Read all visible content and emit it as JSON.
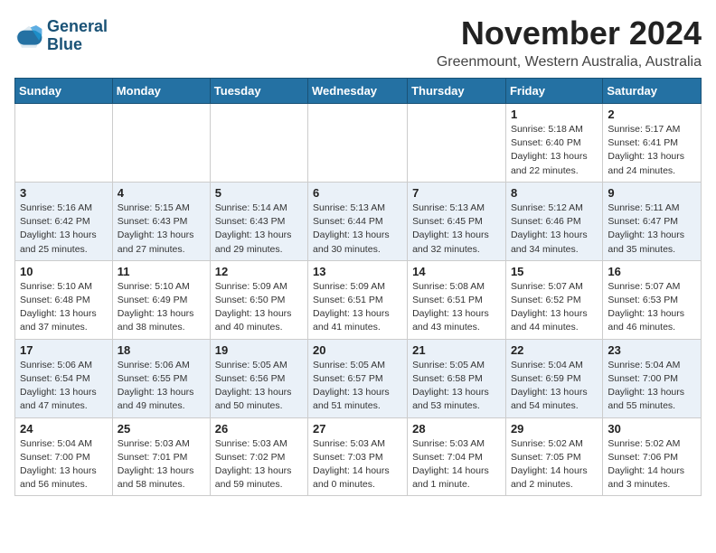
{
  "logo": {
    "line1": "General",
    "line2": "Blue"
  },
  "title": "November 2024",
  "subtitle": "Greenmount, Western Australia, Australia",
  "header": {
    "days": [
      "Sunday",
      "Monday",
      "Tuesday",
      "Wednesday",
      "Thursday",
      "Friday",
      "Saturday"
    ]
  },
  "weeks": [
    [
      {
        "day": "",
        "info": ""
      },
      {
        "day": "",
        "info": ""
      },
      {
        "day": "",
        "info": ""
      },
      {
        "day": "",
        "info": ""
      },
      {
        "day": "",
        "info": ""
      },
      {
        "day": "1",
        "info": "Sunrise: 5:18 AM\nSunset: 6:40 PM\nDaylight: 13 hours\nand 22 minutes."
      },
      {
        "day": "2",
        "info": "Sunrise: 5:17 AM\nSunset: 6:41 PM\nDaylight: 13 hours\nand 24 minutes."
      }
    ],
    [
      {
        "day": "3",
        "info": "Sunrise: 5:16 AM\nSunset: 6:42 PM\nDaylight: 13 hours\nand 25 minutes."
      },
      {
        "day": "4",
        "info": "Sunrise: 5:15 AM\nSunset: 6:43 PM\nDaylight: 13 hours\nand 27 minutes."
      },
      {
        "day": "5",
        "info": "Sunrise: 5:14 AM\nSunset: 6:43 PM\nDaylight: 13 hours\nand 29 minutes."
      },
      {
        "day": "6",
        "info": "Sunrise: 5:13 AM\nSunset: 6:44 PM\nDaylight: 13 hours\nand 30 minutes."
      },
      {
        "day": "7",
        "info": "Sunrise: 5:13 AM\nSunset: 6:45 PM\nDaylight: 13 hours\nand 32 minutes."
      },
      {
        "day": "8",
        "info": "Sunrise: 5:12 AM\nSunset: 6:46 PM\nDaylight: 13 hours\nand 34 minutes."
      },
      {
        "day": "9",
        "info": "Sunrise: 5:11 AM\nSunset: 6:47 PM\nDaylight: 13 hours\nand 35 minutes."
      }
    ],
    [
      {
        "day": "10",
        "info": "Sunrise: 5:10 AM\nSunset: 6:48 PM\nDaylight: 13 hours\nand 37 minutes."
      },
      {
        "day": "11",
        "info": "Sunrise: 5:10 AM\nSunset: 6:49 PM\nDaylight: 13 hours\nand 38 minutes."
      },
      {
        "day": "12",
        "info": "Sunrise: 5:09 AM\nSunset: 6:50 PM\nDaylight: 13 hours\nand 40 minutes."
      },
      {
        "day": "13",
        "info": "Sunrise: 5:09 AM\nSunset: 6:51 PM\nDaylight: 13 hours\nand 41 minutes."
      },
      {
        "day": "14",
        "info": "Sunrise: 5:08 AM\nSunset: 6:51 PM\nDaylight: 13 hours\nand 43 minutes."
      },
      {
        "day": "15",
        "info": "Sunrise: 5:07 AM\nSunset: 6:52 PM\nDaylight: 13 hours\nand 44 minutes."
      },
      {
        "day": "16",
        "info": "Sunrise: 5:07 AM\nSunset: 6:53 PM\nDaylight: 13 hours\nand 46 minutes."
      }
    ],
    [
      {
        "day": "17",
        "info": "Sunrise: 5:06 AM\nSunset: 6:54 PM\nDaylight: 13 hours\nand 47 minutes."
      },
      {
        "day": "18",
        "info": "Sunrise: 5:06 AM\nSunset: 6:55 PM\nDaylight: 13 hours\nand 49 minutes."
      },
      {
        "day": "19",
        "info": "Sunrise: 5:05 AM\nSunset: 6:56 PM\nDaylight: 13 hours\nand 50 minutes."
      },
      {
        "day": "20",
        "info": "Sunrise: 5:05 AM\nSunset: 6:57 PM\nDaylight: 13 hours\nand 51 minutes."
      },
      {
        "day": "21",
        "info": "Sunrise: 5:05 AM\nSunset: 6:58 PM\nDaylight: 13 hours\nand 53 minutes."
      },
      {
        "day": "22",
        "info": "Sunrise: 5:04 AM\nSunset: 6:59 PM\nDaylight: 13 hours\nand 54 minutes."
      },
      {
        "day": "23",
        "info": "Sunrise: 5:04 AM\nSunset: 7:00 PM\nDaylight: 13 hours\nand 55 minutes."
      }
    ],
    [
      {
        "day": "24",
        "info": "Sunrise: 5:04 AM\nSunset: 7:00 PM\nDaylight: 13 hours\nand 56 minutes."
      },
      {
        "day": "25",
        "info": "Sunrise: 5:03 AM\nSunset: 7:01 PM\nDaylight: 13 hours\nand 58 minutes."
      },
      {
        "day": "26",
        "info": "Sunrise: 5:03 AM\nSunset: 7:02 PM\nDaylight: 13 hours\nand 59 minutes."
      },
      {
        "day": "27",
        "info": "Sunrise: 5:03 AM\nSunset: 7:03 PM\nDaylight: 14 hours\nand 0 minutes."
      },
      {
        "day": "28",
        "info": "Sunrise: 5:03 AM\nSunset: 7:04 PM\nDaylight: 14 hours\nand 1 minute."
      },
      {
        "day": "29",
        "info": "Sunrise: 5:02 AM\nSunset: 7:05 PM\nDaylight: 14 hours\nand 2 minutes."
      },
      {
        "day": "30",
        "info": "Sunrise: 5:02 AM\nSunset: 7:06 PM\nDaylight: 14 hours\nand 3 minutes."
      }
    ]
  ]
}
